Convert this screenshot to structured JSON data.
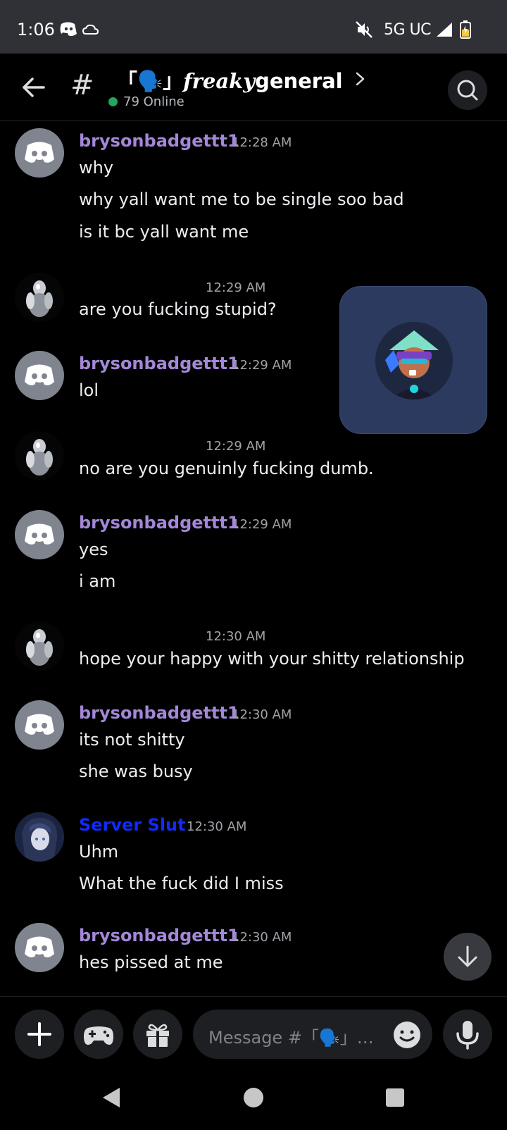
{
  "status_bar": {
    "time": "1:06",
    "network": "5G UC",
    "left_icons": [
      "discord-icon",
      "cloud-icon"
    ],
    "right_icons": [
      "mute-icon",
      "signal-icon",
      "battery-icon"
    ]
  },
  "header": {
    "channel_title_prefix": "「🗣️」",
    "channel_title_fancy": "freaky",
    "channel_title_main": "general",
    "online_count": "79 Online"
  },
  "messages": [
    {
      "author": "brysonbadgettt1",
      "time": "12:28 AM",
      "avatar": "discord-default-avatar",
      "lines": [
        "why",
        "why yall want me to be single soo bad",
        "is it bc  yall want me"
      ]
    },
    {
      "author": "",
      "time": "12:29 AM",
      "avatar": "chrome-robot-avatar",
      "lines": [
        "are you fucking stupid?"
      ]
    },
    {
      "author": "brysonbadgettt1",
      "time": "12:29 AM",
      "avatar": "discord-default-avatar",
      "lines": [
        "lol"
      ]
    },
    {
      "author": "",
      "time": "12:29 AM",
      "avatar": "chrome-robot-avatar",
      "lines": [
        "no are you genuinly fucking dumb."
      ]
    },
    {
      "author": "brysonbadgettt1",
      "time": "12:29 AM",
      "avatar": "discord-default-avatar",
      "lines": [
        "yes",
        "i am"
      ]
    },
    {
      "author": "",
      "time": "12:30 AM",
      "avatar": "chrome-robot-avatar",
      "lines": [
        "hope your happy with your shitty relationship"
      ]
    },
    {
      "author": "brysonbadgettt1",
      "time": "12:30 AM",
      "avatar": "discord-default-avatar",
      "lines": [
        "its not shitty",
        "she was busy"
      ]
    },
    {
      "author": "Server Slut",
      "time": "12:30 AM",
      "avatar": "anime-avatar",
      "lines": [
        "Uhm",
        "What the fuck did I miss"
      ]
    },
    {
      "author": "brysonbadgettt1",
      "time": "12:30 AM",
      "avatar": "discord-default-avatar",
      "lines": [
        "hes pissed at me"
      ]
    }
  ],
  "composer": {
    "placeholder": "Message #「🗣️」…"
  },
  "colors": {
    "background": "#000000",
    "status_bar": "#2f3136",
    "username_purple": "#a387d8",
    "username_blue": "#0f2bff",
    "online_green": "#23a55a",
    "pip_background": "#2b3a5e"
  }
}
